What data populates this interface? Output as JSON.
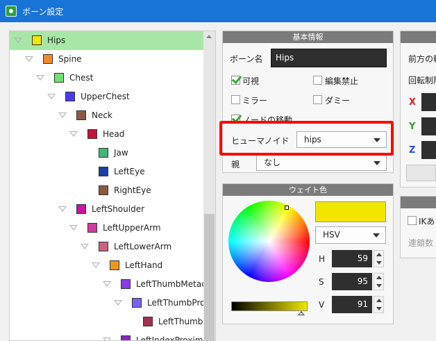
{
  "window": {
    "title": "ボーン設定"
  },
  "tree": {
    "rows": [
      {
        "label": "Hips",
        "color": "#f2e600",
        "depth": 0,
        "selected": true
      },
      {
        "label": "Spine",
        "color": "#f08a24",
        "depth": 1
      },
      {
        "label": "Chest",
        "color": "#6ee06e",
        "depth": 2
      },
      {
        "label": "UpperChest",
        "color": "#4a3be6",
        "depth": 3
      },
      {
        "label": "Neck",
        "color": "#8a5a45",
        "depth": 4
      },
      {
        "label": "Head",
        "color": "#c0143c",
        "depth": 5
      },
      {
        "label": "Jaw",
        "color": "#46b478",
        "depth": 6,
        "leaf": true
      },
      {
        "label": "LeftEye",
        "color": "#1c3ca8",
        "depth": 6,
        "leaf": true
      },
      {
        "label": "RightEye",
        "color": "#8a5a3c",
        "depth": 6,
        "leaf": true
      },
      {
        "label": "LeftShoulder",
        "color": "#d012a0",
        "depth": 4
      },
      {
        "label": "LeftUpperArm",
        "color": "#d23c9c",
        "depth": 5
      },
      {
        "label": "LeftLowerArm",
        "color": "#c86482",
        "depth": 6
      },
      {
        "label": "LeftHand",
        "color": "#f0961e",
        "depth": 7
      },
      {
        "label": "LeftThumbMetac",
        "color": "#8a3ce6",
        "depth": 8
      },
      {
        "label": "LeftThumbPro",
        "color": "#7864ec",
        "depth": 9
      },
      {
        "label": "LeftThumbI",
        "color": "#a03250",
        "depth": 10,
        "leaf": true
      },
      {
        "label": "LeftIndexProxim",
        "color": "#8a28c8",
        "depth": 8
      }
    ]
  },
  "basic_info": {
    "header": "基本情報",
    "bone_name_label": "ボーン名",
    "bone_name_value": "Hips",
    "visible_label": "可視",
    "visible_checked": true,
    "edit_lock_label": "編集禁止",
    "edit_lock_checked": false,
    "mirror_label": "ミラー",
    "mirror_checked": false,
    "dummy_label": "ダミー",
    "dummy_checked": false,
    "node_move_label": "ノードの移動",
    "node_move_checked": true,
    "humanoid_label": "ヒューマノイド",
    "humanoid_value": "hips",
    "parent_label": "親",
    "parent_value": "なし"
  },
  "weight_color": {
    "header": "ウェイト色",
    "preview_color": "#f2e600",
    "mode": "HSV",
    "h_label": "H",
    "h_value": "59",
    "s_label": "S",
    "s_value": "95",
    "v_label": "V",
    "v_value": "91"
  },
  "right_panel": {
    "forward_label": "前方の軸",
    "rotation_limit_label": "回転制限",
    "x_label": "X",
    "y_label": "Y",
    "z_label": "Z",
    "ik_label": "IKあ",
    "chain_label": "連鎖数"
  }
}
